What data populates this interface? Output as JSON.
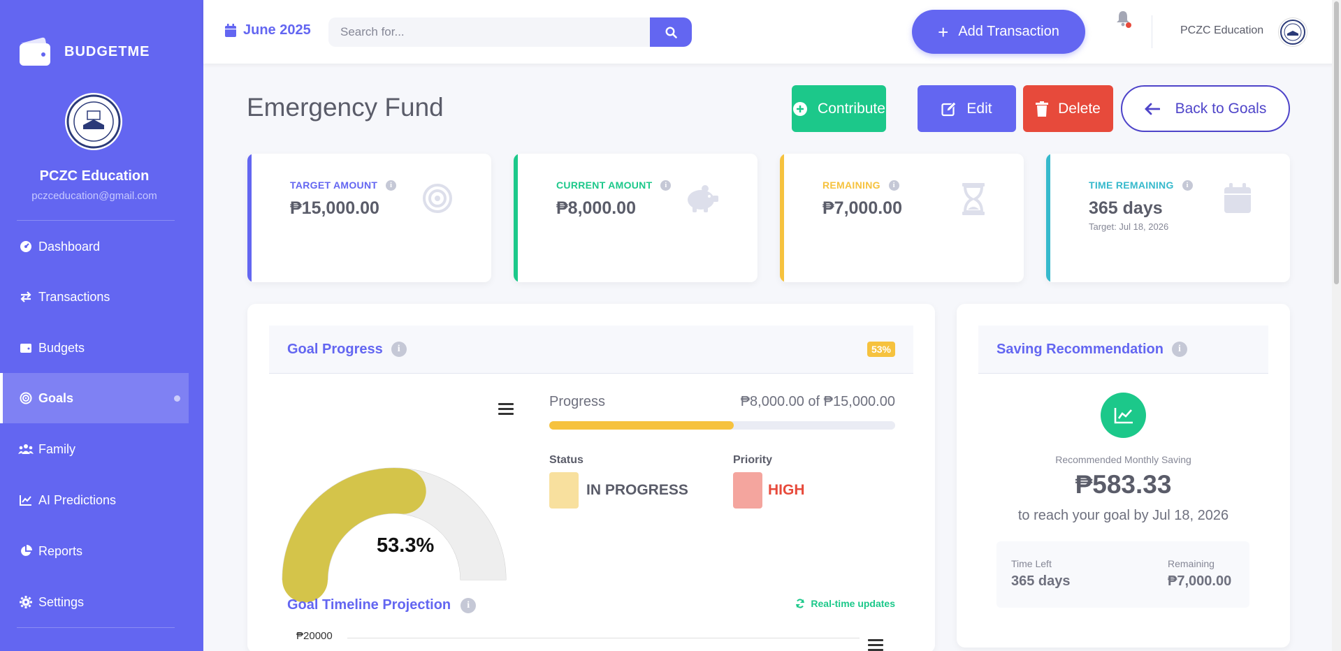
{
  "app": {
    "brand": "BUDGETME",
    "profile_name": "PCZC Education",
    "profile_email": "pczceducation@gmail.com"
  },
  "sidebar": {
    "items": [
      {
        "label": "Dashboard",
        "icon": "gauge-icon"
      },
      {
        "label": "Transactions",
        "icon": "exchange-icon"
      },
      {
        "label": "Budgets",
        "icon": "wallet-icon"
      },
      {
        "label": "Goals",
        "icon": "bullseye-icon",
        "active": true
      },
      {
        "label": "Family",
        "icon": "users-icon"
      },
      {
        "label": "AI Predictions",
        "icon": "chart-line-icon"
      },
      {
        "label": "Reports",
        "icon": "pie-chart-icon"
      },
      {
        "label": "Settings",
        "icon": "gear-icon"
      }
    ]
  },
  "topbar": {
    "month": "June 2025",
    "search_placeholder": "Search for...",
    "add_transaction": "Add Transaction",
    "user_name": "PCZC Education"
  },
  "page": {
    "title": "Emergency Fund",
    "buttons": {
      "contribute": "Contribute",
      "edit": "Edit",
      "delete": "Delete",
      "back": "Back to Goals"
    }
  },
  "stats": [
    {
      "label": "TARGET AMOUNT",
      "value": "₱15,000.00",
      "color": "#6366f1",
      "icon": "bullseye-icon"
    },
    {
      "label": "CURRENT AMOUNT",
      "value": "₱8,000.00",
      "color": "#1cc88a",
      "icon": "piggy-bank-icon"
    },
    {
      "label": "REMAINING",
      "value": "₱7,000.00",
      "color": "#f6c23e",
      "icon": "hourglass-icon"
    },
    {
      "label": "TIME REMAINING",
      "value": "365 days",
      "sub": "Target: Jul 18, 2026",
      "color": "#36b9cc",
      "icon": "calendar-icon"
    }
  ],
  "goal_progress": {
    "title": "Goal Progress",
    "badge": "53%",
    "gauge_value": "53.3%",
    "gauge_fraction": 0.533,
    "progress_label": "Progress",
    "progress_values": "₱8,000.00 of ₱15,000.00",
    "progress_fraction": 0.533,
    "status_label": "Status",
    "status_value": "IN PROGRESS",
    "priority_label": "Priority",
    "priority_value": "HIGH",
    "colors": {
      "gauge_fill": "#d4c44a",
      "gauge_track": "#eeeeee",
      "status": "#f8e09e",
      "priority": "#f4a59e",
      "priority_text": "#e74a3b"
    }
  },
  "timeline": {
    "title": "Goal Timeline Projection",
    "realtime": "Real-time updates",
    "axis_top": "₱20000"
  },
  "recommendation": {
    "title": "Saving Recommendation",
    "caption": "Recommended Monthly Saving",
    "amount": "₱583.33",
    "description": "to reach your goal by Jul 18, 2026",
    "time_left_label": "Time Left",
    "time_left_value": "365 days",
    "remaining_label": "Remaining",
    "remaining_value": "₱7,000.00"
  }
}
